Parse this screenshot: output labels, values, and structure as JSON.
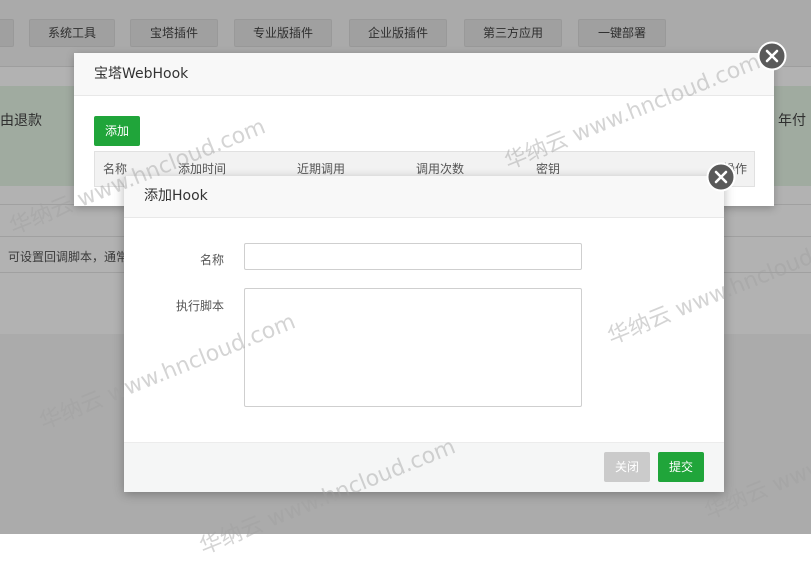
{
  "nav": {
    "tabs": [
      "系统工具",
      "宝塔插件",
      "专业版插件",
      "企业版插件",
      "第三方应用",
      "一键部署"
    ]
  },
  "background": {
    "banner_left": "由退款",
    "banner_right": "年付",
    "row_text": "可设置回调脚本，通常"
  },
  "webhook_dialog": {
    "title": "宝塔WebHook",
    "add_button": "添加",
    "columns": [
      "名称",
      "添加时间",
      "近期调用",
      "调用次数",
      "密钥",
      "操作"
    ]
  },
  "hook_dialog": {
    "title": "添加Hook",
    "name_label": "名称",
    "name_value": "",
    "script_label": "执行脚本",
    "script_value": "",
    "close_button": "关闭",
    "submit_button": "提交"
  },
  "watermark": {
    "text": "华纳云 www.hncloud.com"
  },
  "colors": {
    "accent": "#20a53a",
    "banner": "#e6f5e6",
    "disabled_button": "#cbcbcb"
  }
}
